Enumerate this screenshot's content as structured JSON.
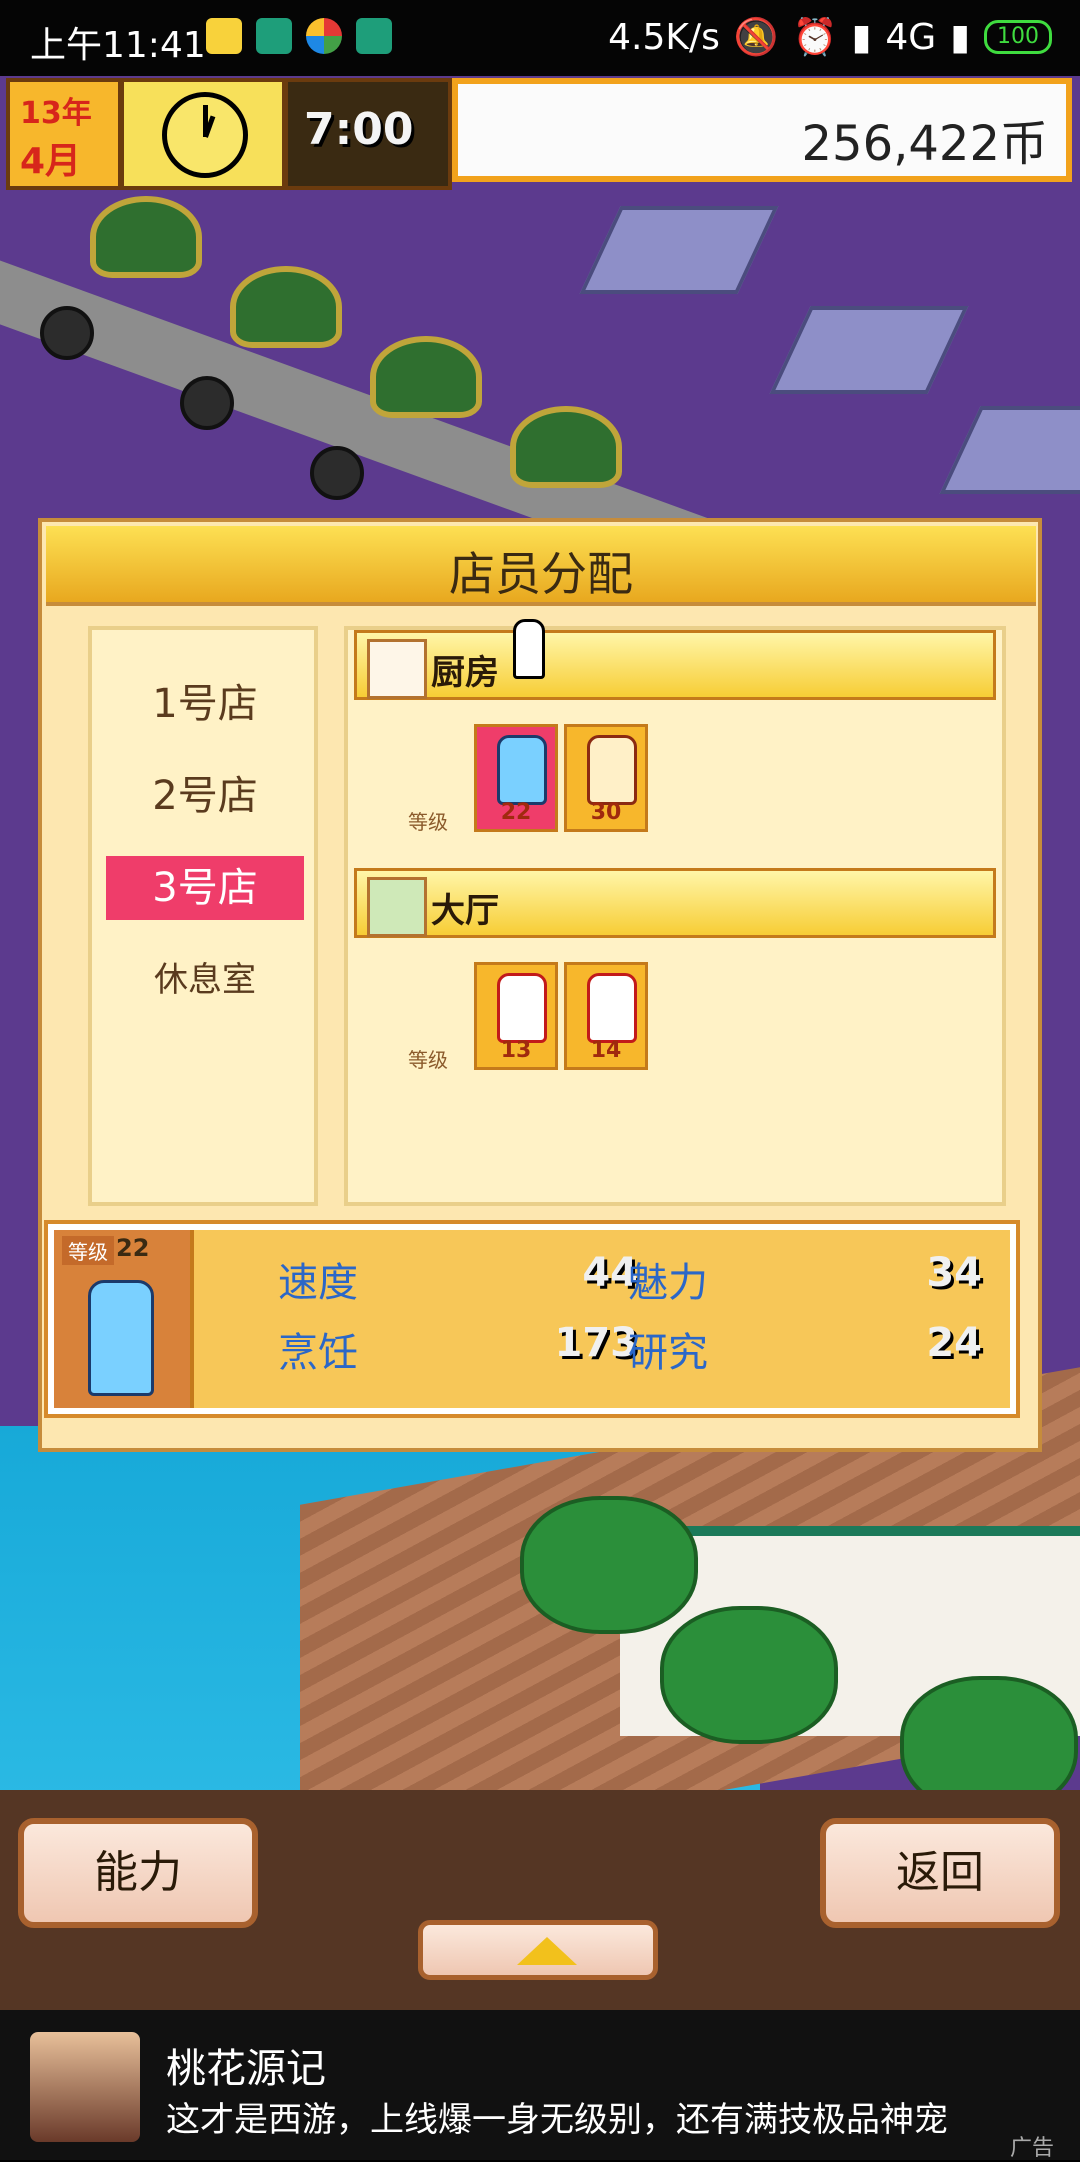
{
  "status_bar": {
    "time": "上午11:41",
    "net_speed": "4.5K/s",
    "network": "4G",
    "battery": "100"
  },
  "hud": {
    "year": "13年",
    "month": "4月",
    "clock_time": "7:00",
    "money": "256,422币"
  },
  "dialog": {
    "title": "店员分配",
    "shops": [
      "1号店",
      "2号店",
      "3号店",
      "休息室"
    ],
    "active_shop_index": 2,
    "sections": [
      {
        "name": "厨房",
        "level_label": "等级",
        "staff": [
          {
            "level": "22",
            "selected": true
          },
          {
            "level": "30",
            "selected": false
          }
        ]
      },
      {
        "name": "大厅",
        "level_label": "等级",
        "staff": [
          {
            "level": "13",
            "selected": false
          },
          {
            "level": "14",
            "selected": false
          }
        ]
      }
    ],
    "selected_staff": {
      "level_label": "等级",
      "level": "22",
      "stats": [
        {
          "label": "速度",
          "value": "44"
        },
        {
          "label": "魅力",
          "value": "34"
        },
        {
          "label": "烹饪",
          "value": "173"
        },
        {
          "label": "研究",
          "value": "24"
        }
      ]
    }
  },
  "buttons": {
    "ability": "能力",
    "back": "返回"
  },
  "ad": {
    "title": "桃花源记",
    "description": "这才是西游，上线爆一身无级别，还有满技极品神宠",
    "label": "广告"
  },
  "colors": {
    "accent_pink": "#ef3d6a",
    "panel_yellow": "#f7c758",
    "stat_blue": "#2b67c8"
  }
}
